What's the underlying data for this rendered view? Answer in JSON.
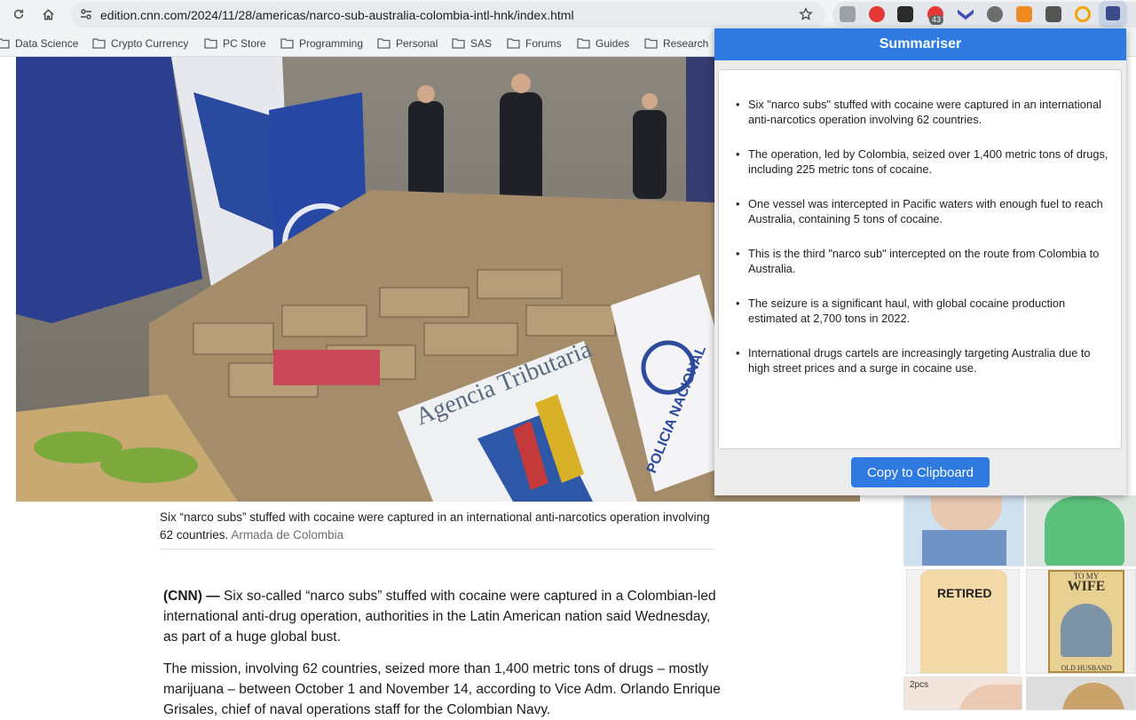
{
  "browser": {
    "url": "edition.cnn.com/2024/11/28/americas/narco-sub-australia-colombia-intl-hnk/index.html",
    "extensions_badge": "43",
    "bookmarks": [
      {
        "label": "Data Science"
      },
      {
        "label": "Crypto Currency"
      },
      {
        "label": "PC Store"
      },
      {
        "label": "Programming"
      },
      {
        "label": "Personal"
      },
      {
        "label": "SAS"
      },
      {
        "label": "Forums"
      },
      {
        "label": "Guides"
      },
      {
        "label": "Research"
      }
    ]
  },
  "article": {
    "caption": "Six “narco subs” stuffed with cocaine were captured in an international anti-narcotics operation involving 62 countries.",
    "caption_credit": "Armada de Colombia",
    "dateline": "(CNN) —",
    "paragraph1": "Six so-called “narco subs” stuffed with cocaine were captured in a Colombian-led international anti-drug operation, authorities in the Latin American nation said Wednesday, as part of a huge global bust.",
    "paragraph2": "The mission, involving 62 countries, seized more than 1,400 metric tons of drugs – mostly marijuana – between October 1 and November 14, according to Vice Adm. Orlando Enrique Grisales, chief of naval operations staff for the Colombian Navy.",
    "photo_signs": {
      "agency": "Agencia Tributaria",
      "policia": "POLICIA NACIONAL"
    }
  },
  "ads": {
    "shirt_text": "RETIRED",
    "poster_top": "TO MY",
    "poster_wife": "WIFE",
    "poster_bottom": "OLD HUSBAND",
    "pack_label": "2pcs"
  },
  "summariser": {
    "title": "Summariser",
    "bullets": [
      "Six \"narco subs\" stuffed with cocaine were captured in an international anti-narcotics operation involving 62 countries.",
      "The operation, led by Colombia, seized over 1,400 metric tons of drugs, including 225 metric tons of cocaine.",
      "One vessel was intercepted in Pacific waters with enough fuel to reach Australia, containing 5 tons of cocaine.",
      "This is the third \"narco sub\" intercepted on the route from Colombia to Australia.",
      "The seizure is a significant haul, with global cocaine production estimated at 2,700 tons in 2022.",
      "International drugs cartels are increasingly targeting Australia due to high street prices and a surge in cocaine use."
    ],
    "copy_label": "Copy to Clipboard"
  },
  "colors": {
    "accent": "#2f7ae0",
    "chrome_bg": "#f1f3f4"
  }
}
